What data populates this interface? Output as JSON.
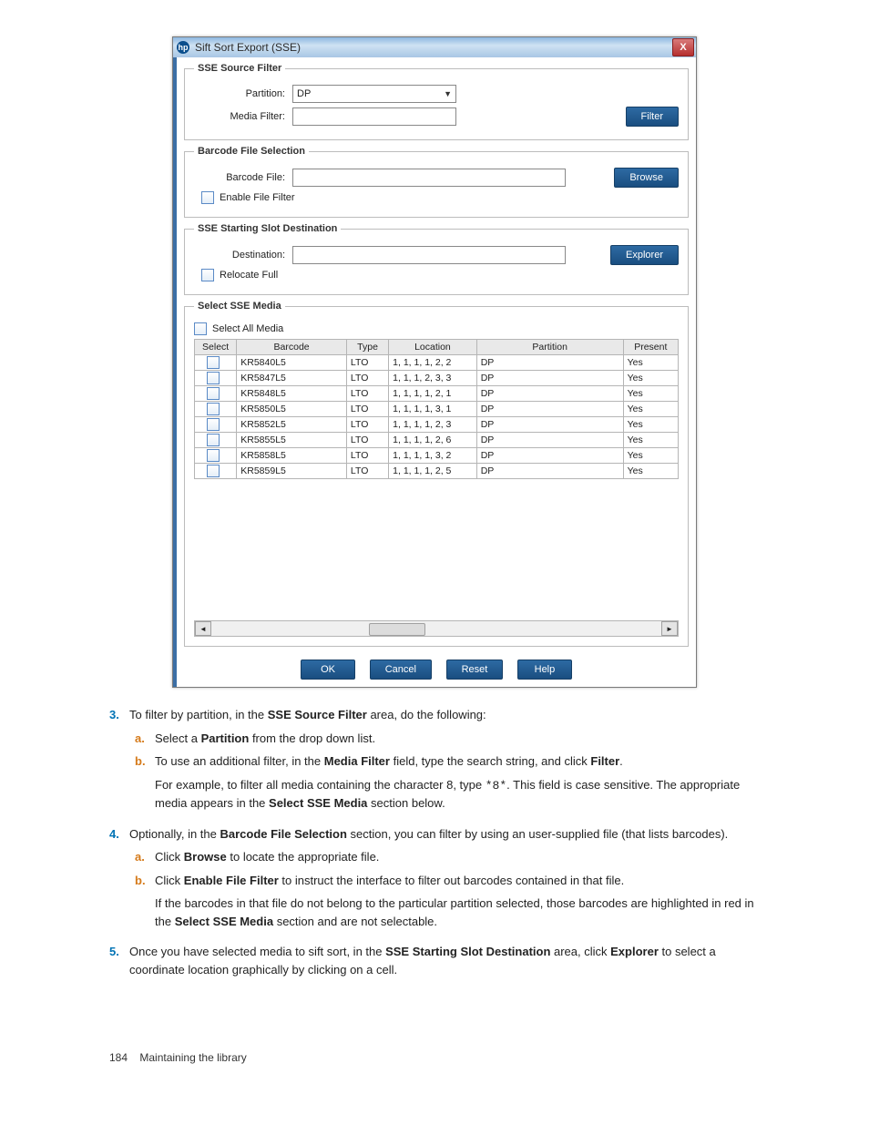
{
  "dialog": {
    "title": "Sift Sort Export (SSE)",
    "logo": "hp",
    "close": "X",
    "groups": {
      "sourceFilter": {
        "legend": "SSE Source Filter",
        "partitionLabel": "Partition:",
        "partitionValue": "DP",
        "mediaFilterLabel": "Media Filter:",
        "filterBtn": "Filter"
      },
      "barcodeFile": {
        "legend": "Barcode File Selection",
        "barcodeFileLabel": "Barcode File:",
        "browseBtn": "Browse",
        "enableFilter": "Enable File Filter"
      },
      "startSlot": {
        "legend": "SSE Starting Slot Destination",
        "destinationLabel": "Destination:",
        "explorerBtn": "Explorer",
        "relocateFull": "Relocate Full"
      },
      "selectMedia": {
        "legend": "Select SSE Media",
        "selectAll": "Select All Media",
        "headers": [
          "Select",
          "Barcode",
          "Type",
          "Location",
          "Partition",
          "Present"
        ],
        "rows": [
          {
            "barcode": "KR5840L5",
            "type": "LTO",
            "location": "1, 1, 1, 1, 2, 2",
            "partition": "DP",
            "present": "Yes"
          },
          {
            "barcode": "KR5847L5",
            "type": "LTO",
            "location": "1, 1, 1, 2, 3, 3",
            "partition": "DP",
            "present": "Yes"
          },
          {
            "barcode": "KR5848L5",
            "type": "LTO",
            "location": "1, 1, 1, 1, 2, 1",
            "partition": "DP",
            "present": "Yes"
          },
          {
            "barcode": "KR5850L5",
            "type": "LTO",
            "location": "1, 1, 1, 1, 3, 1",
            "partition": "DP",
            "present": "Yes"
          },
          {
            "barcode": "KR5852L5",
            "type": "LTO",
            "location": "1, 1, 1, 1, 2, 3",
            "partition": "DP",
            "present": "Yes"
          },
          {
            "barcode": "KR5855L5",
            "type": "LTO",
            "location": "1, 1, 1, 1, 2, 6",
            "partition": "DP",
            "present": "Yes"
          },
          {
            "barcode": "KR5858L5",
            "type": "LTO",
            "location": "1, 1, 1, 1, 3, 2",
            "partition": "DP",
            "present": "Yes"
          },
          {
            "barcode": "KR5859L5",
            "type": "LTO",
            "location": "1, 1, 1, 1, 2, 5",
            "partition": "DP",
            "present": "Yes"
          }
        ]
      }
    },
    "buttons": {
      "ok": "OK",
      "cancel": "Cancel",
      "reset": "Reset",
      "help": "Help"
    }
  },
  "instructions": {
    "step3": {
      "text_a": "To filter by partition, in the ",
      "bold_a": "SSE Source Filter",
      "text_b": " area, do the following:",
      "sub_a_1": "Select a ",
      "sub_a_bold": "Partition",
      "sub_a_2": " from the drop down list.",
      "sub_b_1": "To use an additional filter, in the ",
      "sub_b_bold": "Media Filter",
      "sub_b_2": " field, type the search string, and click ",
      "sub_b_bold2": "Filter",
      "sub_b_3": ".",
      "sub_b_para_1": "For example, to filter all media containing the character 8, type ",
      "sub_b_mono": "*8*",
      "sub_b_para_2": ". This field is case sensitive. The appropriate media appears in the ",
      "sub_b_bold3": "Select SSE Media",
      "sub_b_para_3": " section below."
    },
    "step4": {
      "text_a": "Optionally, in the ",
      "bold_a": "Barcode File Selection",
      "text_b": " section, you can filter by using an user-supplied file (that lists barcodes).",
      "sub_a_1": "Click ",
      "sub_a_bold": "Browse",
      "sub_a_2": " to locate the appropriate file.",
      "sub_b_1": "Click ",
      "sub_b_bold": "Enable File Filter",
      "sub_b_2": " to instruct the interface to filter out barcodes contained in that file.",
      "sub_b_para_1": "If the barcodes in that file do not belong to the particular partition selected, those barcodes are highlighted in red in the ",
      "sub_b_bold2": "Select SSE Media",
      "sub_b_para_2": " section and are not selectable."
    },
    "step5": {
      "text_a": "Once you have selected media to sift sort, in the ",
      "bold_a": "SSE Starting Slot Destination",
      "text_b": " area, click ",
      "bold_b": "Explorer",
      "text_c": " to select a coordinate location graphically by clicking on a cell."
    }
  },
  "footer": {
    "page": "184",
    "section": "Maintaining the library"
  }
}
